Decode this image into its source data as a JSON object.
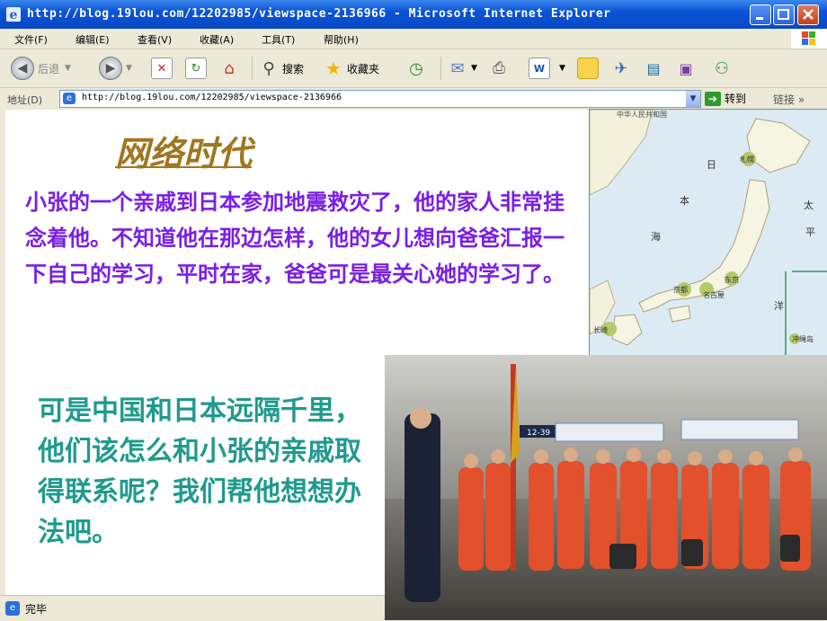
{
  "window": {
    "title": "http://blog.19lou.com/12202985/viewspace-2136966 - Microsoft Internet Explorer"
  },
  "menu": [
    {
      "label": "文件(F)"
    },
    {
      "label": "编辑(E)"
    },
    {
      "label": "查看(V)"
    },
    {
      "label": "收藏(A)"
    },
    {
      "label": "工具(T)"
    },
    {
      "label": "帮助(H)"
    }
  ],
  "toolbar": {
    "back_label": "后退",
    "search_label": "搜索",
    "favorites_label": "收藏夹"
  },
  "address": {
    "label": "地址(D)",
    "url": "http://blog.19lou.com/12202985/viewspace-2136966",
    "go_label": "转到",
    "links_label": "链接"
  },
  "slide": {
    "title": "网络时代",
    "paragraph1": "小张的一个亲戚到日本参加地震救灾了，他的家人非常挂念着他。不知道他在那边怎样，他的女儿想向爸爸汇报一下自己的学习，平时在家，爸爸可是最关心她的学习了。",
    "paragraph2": "可是中国和日本远隔千里，他们该怎么和小张的亲戚取得联系呢？我们帮他想想办法吧。"
  },
  "map": {
    "header": "中华人民共和国",
    "labels": [
      "日",
      "本",
      "海",
      "太",
      "平",
      "洋",
      "札幌",
      "京都",
      "名古屋",
      "东京",
      "长崎",
      "冲绳岛"
    ]
  },
  "photo": {
    "sign_number": "12-39"
  },
  "status": {
    "text": "完毕"
  },
  "colors": {
    "title_bar": "#0a54d6",
    "heading": "#a0761e",
    "paragraph1": "#7a1ee6",
    "paragraph2": "#1f9a8e",
    "uniform": "#e2502c"
  }
}
